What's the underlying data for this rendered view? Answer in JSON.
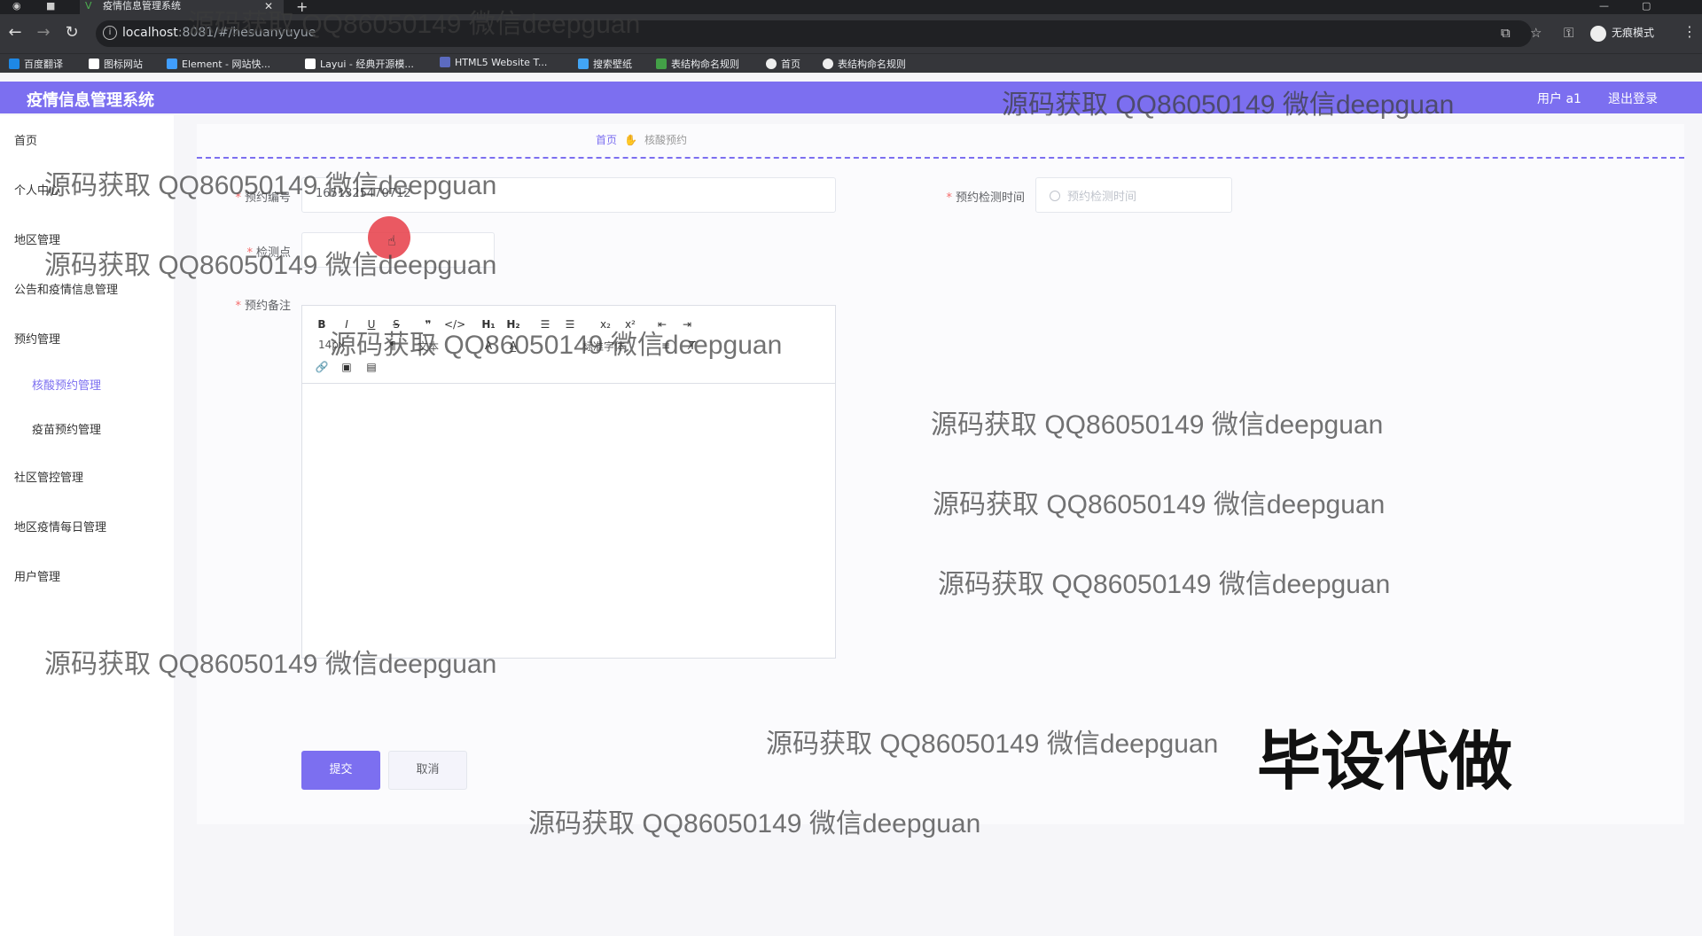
{
  "browser": {
    "tab_title": "疫情信息管理系统",
    "url_host": "localhost",
    "url_rest": ":8081/#/hesuanyuyue",
    "incognito_label": "无痕模式",
    "bookmarks": [
      {
        "label": "百度翻译",
        "color": "#1e88e5"
      },
      {
        "label": "图标网站",
        "color": "#ffffff"
      },
      {
        "label": "Element - 网站快...",
        "color": "#409eff"
      },
      {
        "label": "Layui - 经典开源模...",
        "color": "#ffffff"
      },
      {
        "label": "HTML5 Website T...",
        "color": "#5c6bc0"
      },
      {
        "label": "搜索壁纸",
        "color": "#42a5f5"
      },
      {
        "label": "表结构命名规则",
        "color": "#43a047"
      },
      {
        "label": "首页",
        "color": "#eeeeee"
      },
      {
        "label": "表结构命名规则",
        "color": "#eeeeee"
      }
    ]
  },
  "header": {
    "title": "疫情信息管理系统",
    "user": "用户 a1",
    "logout": "退出登录"
  },
  "sidebar": {
    "items": [
      "首页",
      "个人中心",
      "地区管理",
      "公告和疫情信息管理",
      "预约管理",
      "核酸预约管理",
      "疫苗预约管理",
      "社区管控管理",
      "地区疫情每日管理",
      "用户管理"
    ]
  },
  "breadcrumb": {
    "home": "首页",
    "current": "核酸预约"
  },
  "form": {
    "booking_no_label": "预约编号",
    "booking_no_value": "1651325470712",
    "test_time_label": "预约检测时间",
    "test_time_placeholder": "预约检测时间",
    "test_point_label": "检测点",
    "remark_label": "预约备注",
    "submit": "提交",
    "cancel": "取消"
  },
  "editor": {
    "font_size": "14px",
    "text_style": "文本",
    "font_family": "标准字体"
  },
  "watermark": "源码获取 QQ86050149 微信deepguan",
  "stamp": "毕设代做",
  "colors": {
    "accent": "#7c6ff0",
    "required": "#f56c6c"
  }
}
